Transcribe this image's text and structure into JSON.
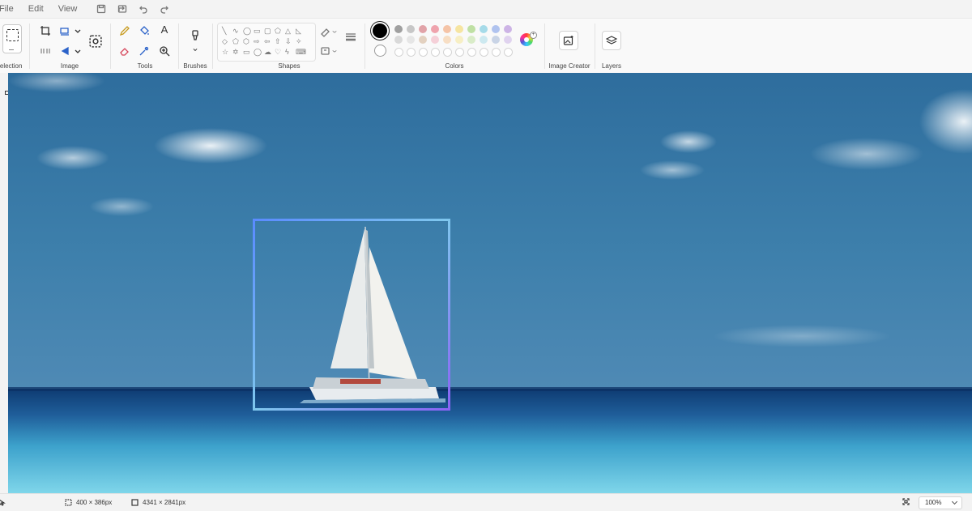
{
  "menu": {
    "file": "File",
    "edit": "Edit",
    "view": "View"
  },
  "ribbon": {
    "groups": {
      "selection": "Selection",
      "image": "Image",
      "tools": "Tools",
      "brushes": "Brushes",
      "shapes": "Shapes",
      "colors": "Colors",
      "image_creator": "Image Creator",
      "layers": "Layers"
    },
    "text_tool_glyph": "A",
    "primary_color": "#000000",
    "secondary_color": "#ffffff",
    "palette_row1": [
      "#a0a0a0",
      "#c7c7c7",
      "#e1a3a8",
      "#efa3ad",
      "#f5c4a7",
      "#f6e5a1",
      "#bfe0a4",
      "#a6dbe9",
      "#b0c3ef",
      "#cdb4e6"
    ],
    "palette_row2": [
      "#d9d9d9",
      "#e6e6e6",
      "#e3d1c0",
      "#f5d0d8",
      "#f7dec4",
      "#f7efc4",
      "#d9ecc8",
      "#cde9f0",
      "#c9d4e6",
      "#e0d3ef"
    ]
  },
  "status": {
    "selection_size": "400 × 386px",
    "canvas_size": "4341 × 2841px",
    "zoom": "100%"
  }
}
